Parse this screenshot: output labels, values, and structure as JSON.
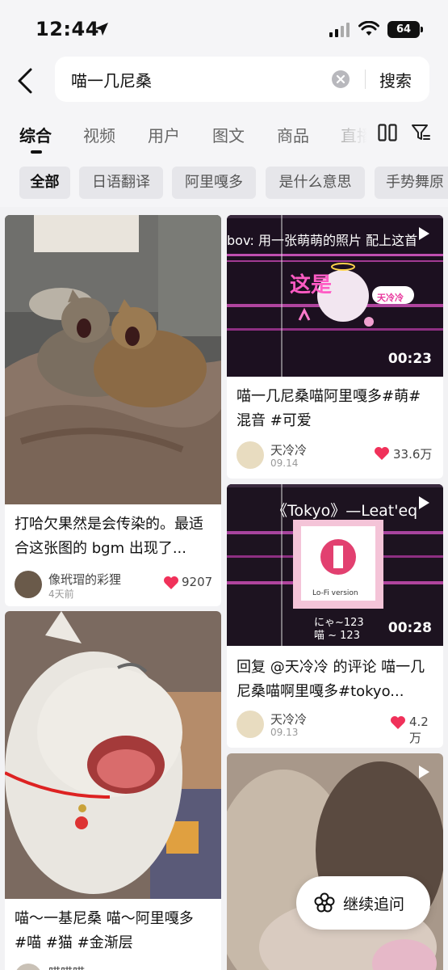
{
  "status_bar": {
    "time": "12:44",
    "battery": "64"
  },
  "search": {
    "query": "喵一几尼桑",
    "button_label": "搜索"
  },
  "tabs": [
    {
      "label": "综合",
      "active": true
    },
    {
      "label": "视频"
    },
    {
      "label": "用户"
    },
    {
      "label": "图文"
    },
    {
      "label": "商品"
    },
    {
      "label": "直播"
    }
  ],
  "chips": [
    {
      "label": "全部",
      "active": true
    },
    {
      "label": "日语翻译"
    },
    {
      "label": "阿里嘎多"
    },
    {
      "label": "是什么意思"
    },
    {
      "label": "手势舞原"
    }
  ],
  "feed": {
    "left": [
      {
        "title": "打哈欠果然是会传染的。最适合这张图的 bgm 出现了...",
        "author": "像玳瑁的彩狸",
        "date": "4天前",
        "likes": "9207"
      },
      {
        "title": "喵～一基尼桑 喵～阿里嘎多 #喵 #猫 #金渐层",
        "author": "喵喵喵"
      }
    ],
    "right": [
      {
        "overlay_text": "bov: 用一张萌萌的照片 配上这首",
        "overlay_caption": "这是",
        "overlay_badge": "天冷冷",
        "duration": "00:23",
        "title": "喵一几尼桑喵阿里嘎多#萌#混音 #可爱",
        "author": "天冷冷",
        "date": "09.14",
        "likes": "33.6万"
      },
      {
        "overlay_title": "《Tokyo》—Leat'eq",
        "overlay_album": "Lo-Fi version",
        "overlay_lyric1": "にゃ~123",
        "overlay_lyric2": "喵 ~ 123",
        "duration": "00:28",
        "title": "回复 @天冷冷 的评论 喵一几尼桑喵啊里嘎多#tokyo...",
        "author": "天冷冷",
        "date": "09.13",
        "likes": "4.2万"
      }
    ]
  },
  "follow_button": {
    "label": "继续追问"
  },
  "colors": {
    "like": "#f0315a",
    "chip_bg": "#e6e6ea",
    "accent_pink": "#ff4fb8"
  }
}
